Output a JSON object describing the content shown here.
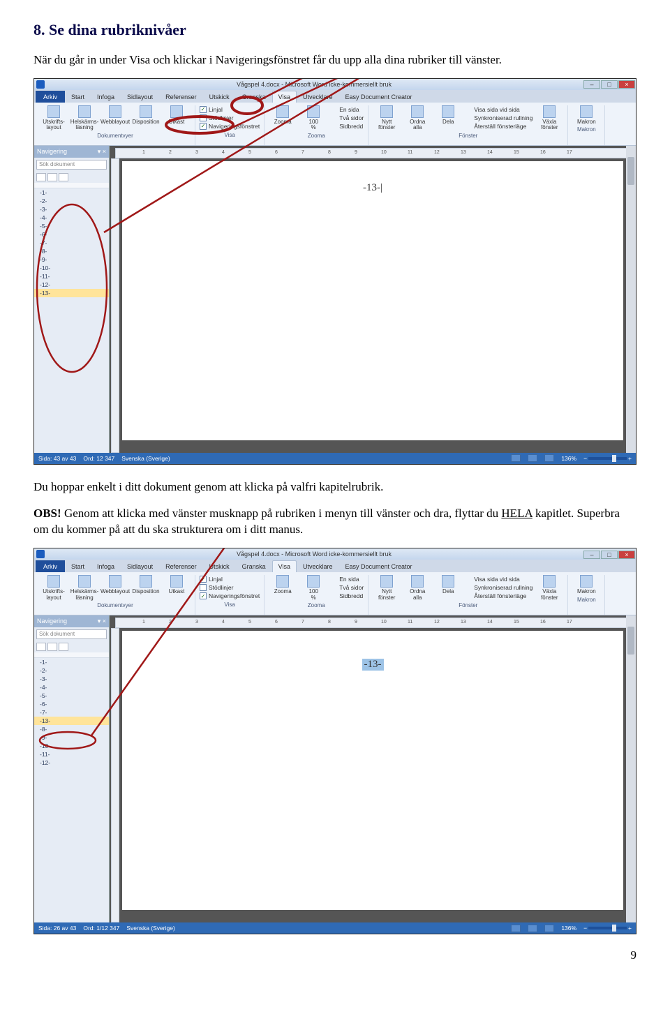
{
  "heading": "8.  Se dina rubriknivåer",
  "intro": "När du går in under Visa och klickar i Navigeringsfönstret får du upp alla dina rubriker till vänster.",
  "after1": "Du hoppar enkelt i ditt dokument genom att klicka på valfri kapitelrubrik.",
  "obs_label": "OBS!",
  "obs_text": " Genom att klicka med vänster musknapp på rubriken i menyn till vänster och dra, flyttar du ",
  "obs_under": "HELA",
  "obs_tail": " kapitlet. Superbra om du kommer på att du ska strukturera om i ditt manus.",
  "page_number": "9",
  "word": {
    "title": "Vågspel 4.docx - Microsoft Word icke-kommersiellt bruk",
    "tabs": [
      "Arkiv",
      "Start",
      "Infoga",
      "Sidlayout",
      "Referenser",
      "Utskick",
      "Granska",
      "Visa",
      "Utvecklare",
      "Easy Document Creator"
    ],
    "ribbon": {
      "views_group": "Dokumentvyer",
      "views": [
        "Utskrifts-\nlayout",
        "Helskärms-\nläsning",
        "Webblayout",
        "Disposition",
        "Utkast"
      ],
      "show_group": "Visa",
      "show": [
        {
          "label": "Linjal",
          "checked": true
        },
        {
          "label": "Stödlinjer",
          "checked": false
        },
        {
          "label": "Navigeringsfönstret",
          "checked": true
        }
      ],
      "zoom_group": "Zooma",
      "zoom": [
        "Zooma",
        "100\n%",
        "En sida",
        "Två sidor",
        "Sidbredd"
      ],
      "window_group": "Fönster",
      "window_btns": [
        "Nytt\nfönster",
        "Ordna\nalla",
        "Dela"
      ],
      "window_chks": [
        "Visa sida vid sida",
        "Synkroniserad rullning",
        "Återställ fönsterläge"
      ],
      "switch": "Växla\nfönster",
      "macros_group": "Makron",
      "macros": "Makron"
    },
    "nav": {
      "header": "Navigering",
      "search_ph": "Sök dokument",
      "items1": [
        "-1-",
        "-2-",
        "-3-",
        "-4-",
        "-5-",
        "-6-",
        "-7-",
        "-8-",
        "-9-",
        "-10-",
        "-11-",
        "-12-",
        "-13-"
      ],
      "items2": [
        "-1-",
        "-2-",
        "-3-",
        "-4-",
        "-5-",
        "-6-",
        "-7-",
        "-13-",
        "-8-",
        "-9-",
        "-10-",
        "-11-",
        "-12-"
      ],
      "selected1": "-13-",
      "selected2": "-13-"
    },
    "page_text": "-13-",
    "page_text_cursor": "|",
    "status1": {
      "page": "Sida: 43 av 43",
      "words": "Ord: 12 347",
      "lang": "Svenska (Sverige)",
      "zoom": "136%"
    },
    "status2": {
      "page": "Sida: 26 av 43",
      "words": "Ord: 1/12 347",
      "lang": "Svenska (Sverige)",
      "zoom": "136%"
    }
  },
  "ruler_ticks": [
    1,
    2,
    3,
    4,
    5,
    6,
    7,
    8,
    9,
    10,
    11,
    12,
    13,
    14,
    15,
    16,
    17
  ]
}
